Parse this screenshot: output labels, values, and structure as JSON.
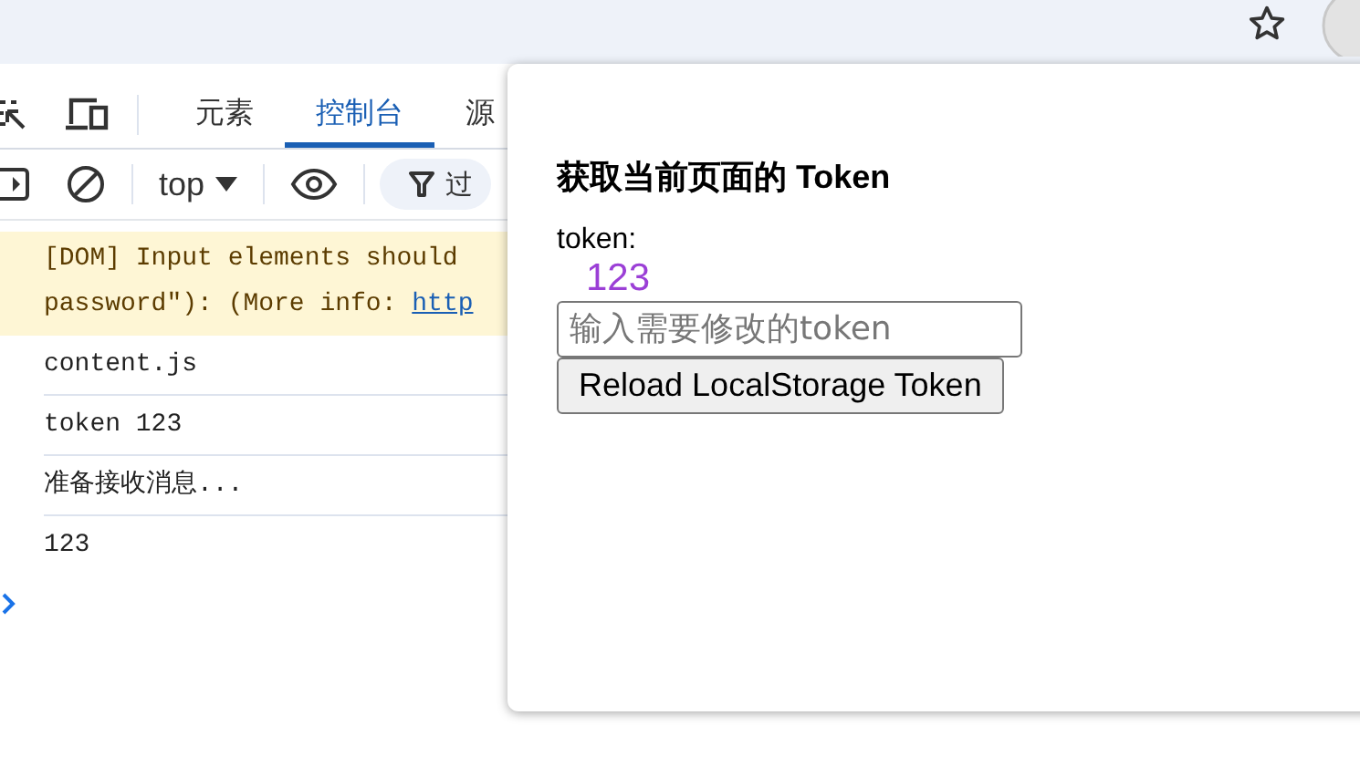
{
  "devtools": {
    "tabs": [
      {
        "label": "元素",
        "selected": false
      },
      {
        "label": "控制台",
        "selected": true
      },
      {
        "label": "源",
        "selected": false
      }
    ],
    "toolbar": {
      "context": "top",
      "filter_placeholder": "过"
    },
    "console": [
      {
        "kind": "warning",
        "lines": [
          "[DOM] Input elements should",
          "password\"): (More info: "
        ],
        "link": "http"
      },
      {
        "kind": "log",
        "text": "content.js"
      },
      {
        "kind": "log",
        "text": "token 123"
      },
      {
        "kind": "log",
        "text": "准备接收消息..."
      },
      {
        "kind": "log",
        "text": "123"
      }
    ]
  },
  "popup": {
    "title": "获取当前页面的 Token",
    "token_label": "token:",
    "token_value": "123",
    "input": {
      "placeholder": "输入需要修改的token"
    },
    "button": "Reload LocalStorage Token"
  }
}
